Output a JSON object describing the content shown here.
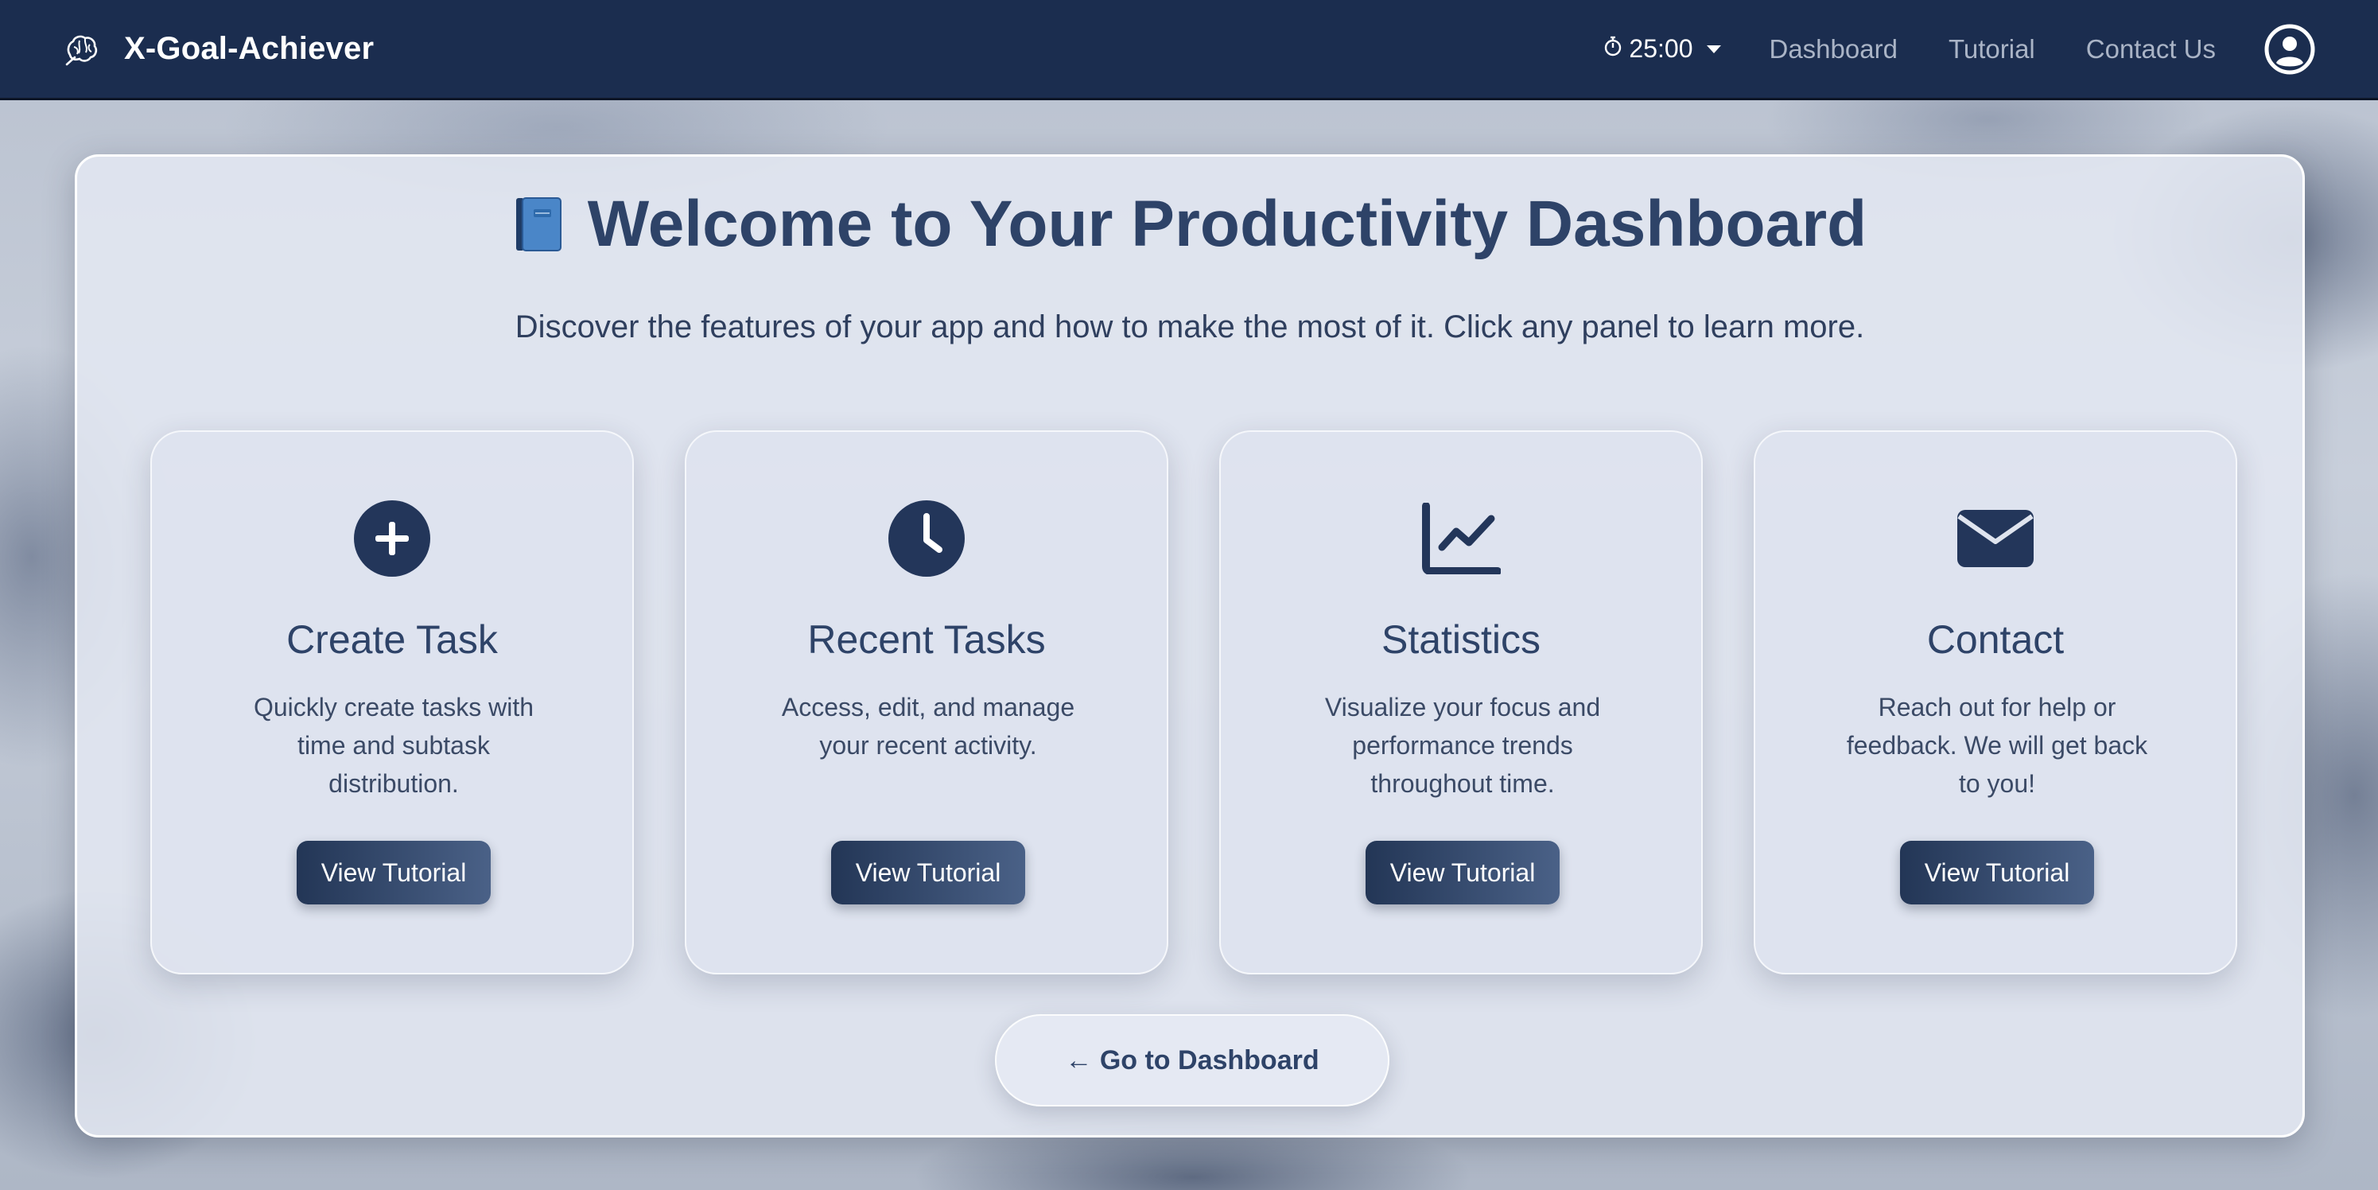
{
  "navbar": {
    "brand": "X-Goal-Achiever",
    "logo_icon": "brain-icon",
    "timer": "25:00",
    "timer_icon": "stopwatch-icon",
    "links": [
      "Dashboard",
      "Tutorial",
      "Contact Us"
    ],
    "user_icon": "user-circle-icon"
  },
  "main": {
    "title": "Welcome to Your Productivity Dashboard",
    "title_icon": "blue-book-icon",
    "subtitle": "Discover the features of your app and how to make the most of it. Click any panel to learn more.",
    "cards": [
      {
        "icon": "plus-circle-icon",
        "title": "Create Task",
        "description": "Quickly create tasks with time and subtask distribution.",
        "button": "View Tutorial"
      },
      {
        "icon": "clock-icon",
        "title": "Recent Tasks",
        "description": "Access, edit, and manage your recent activity.",
        "button": "View Tutorial"
      },
      {
        "icon": "line-chart-icon",
        "title": "Statistics",
        "description": "Visualize your focus and performance trends throughout time.",
        "button": "View Tutorial"
      },
      {
        "icon": "envelope-icon",
        "title": "Contact",
        "description": "Reach out for help or feedback. We will get back to you!",
        "button": "View Tutorial"
      }
    ],
    "dashboard_button": "← Go to Dashboard"
  },
  "colors": {
    "navbar_bg": "#1b2d4f",
    "title": "#2e4368",
    "icon": "#23365a",
    "button_start": "#233656",
    "button_end": "#4a6187"
  }
}
